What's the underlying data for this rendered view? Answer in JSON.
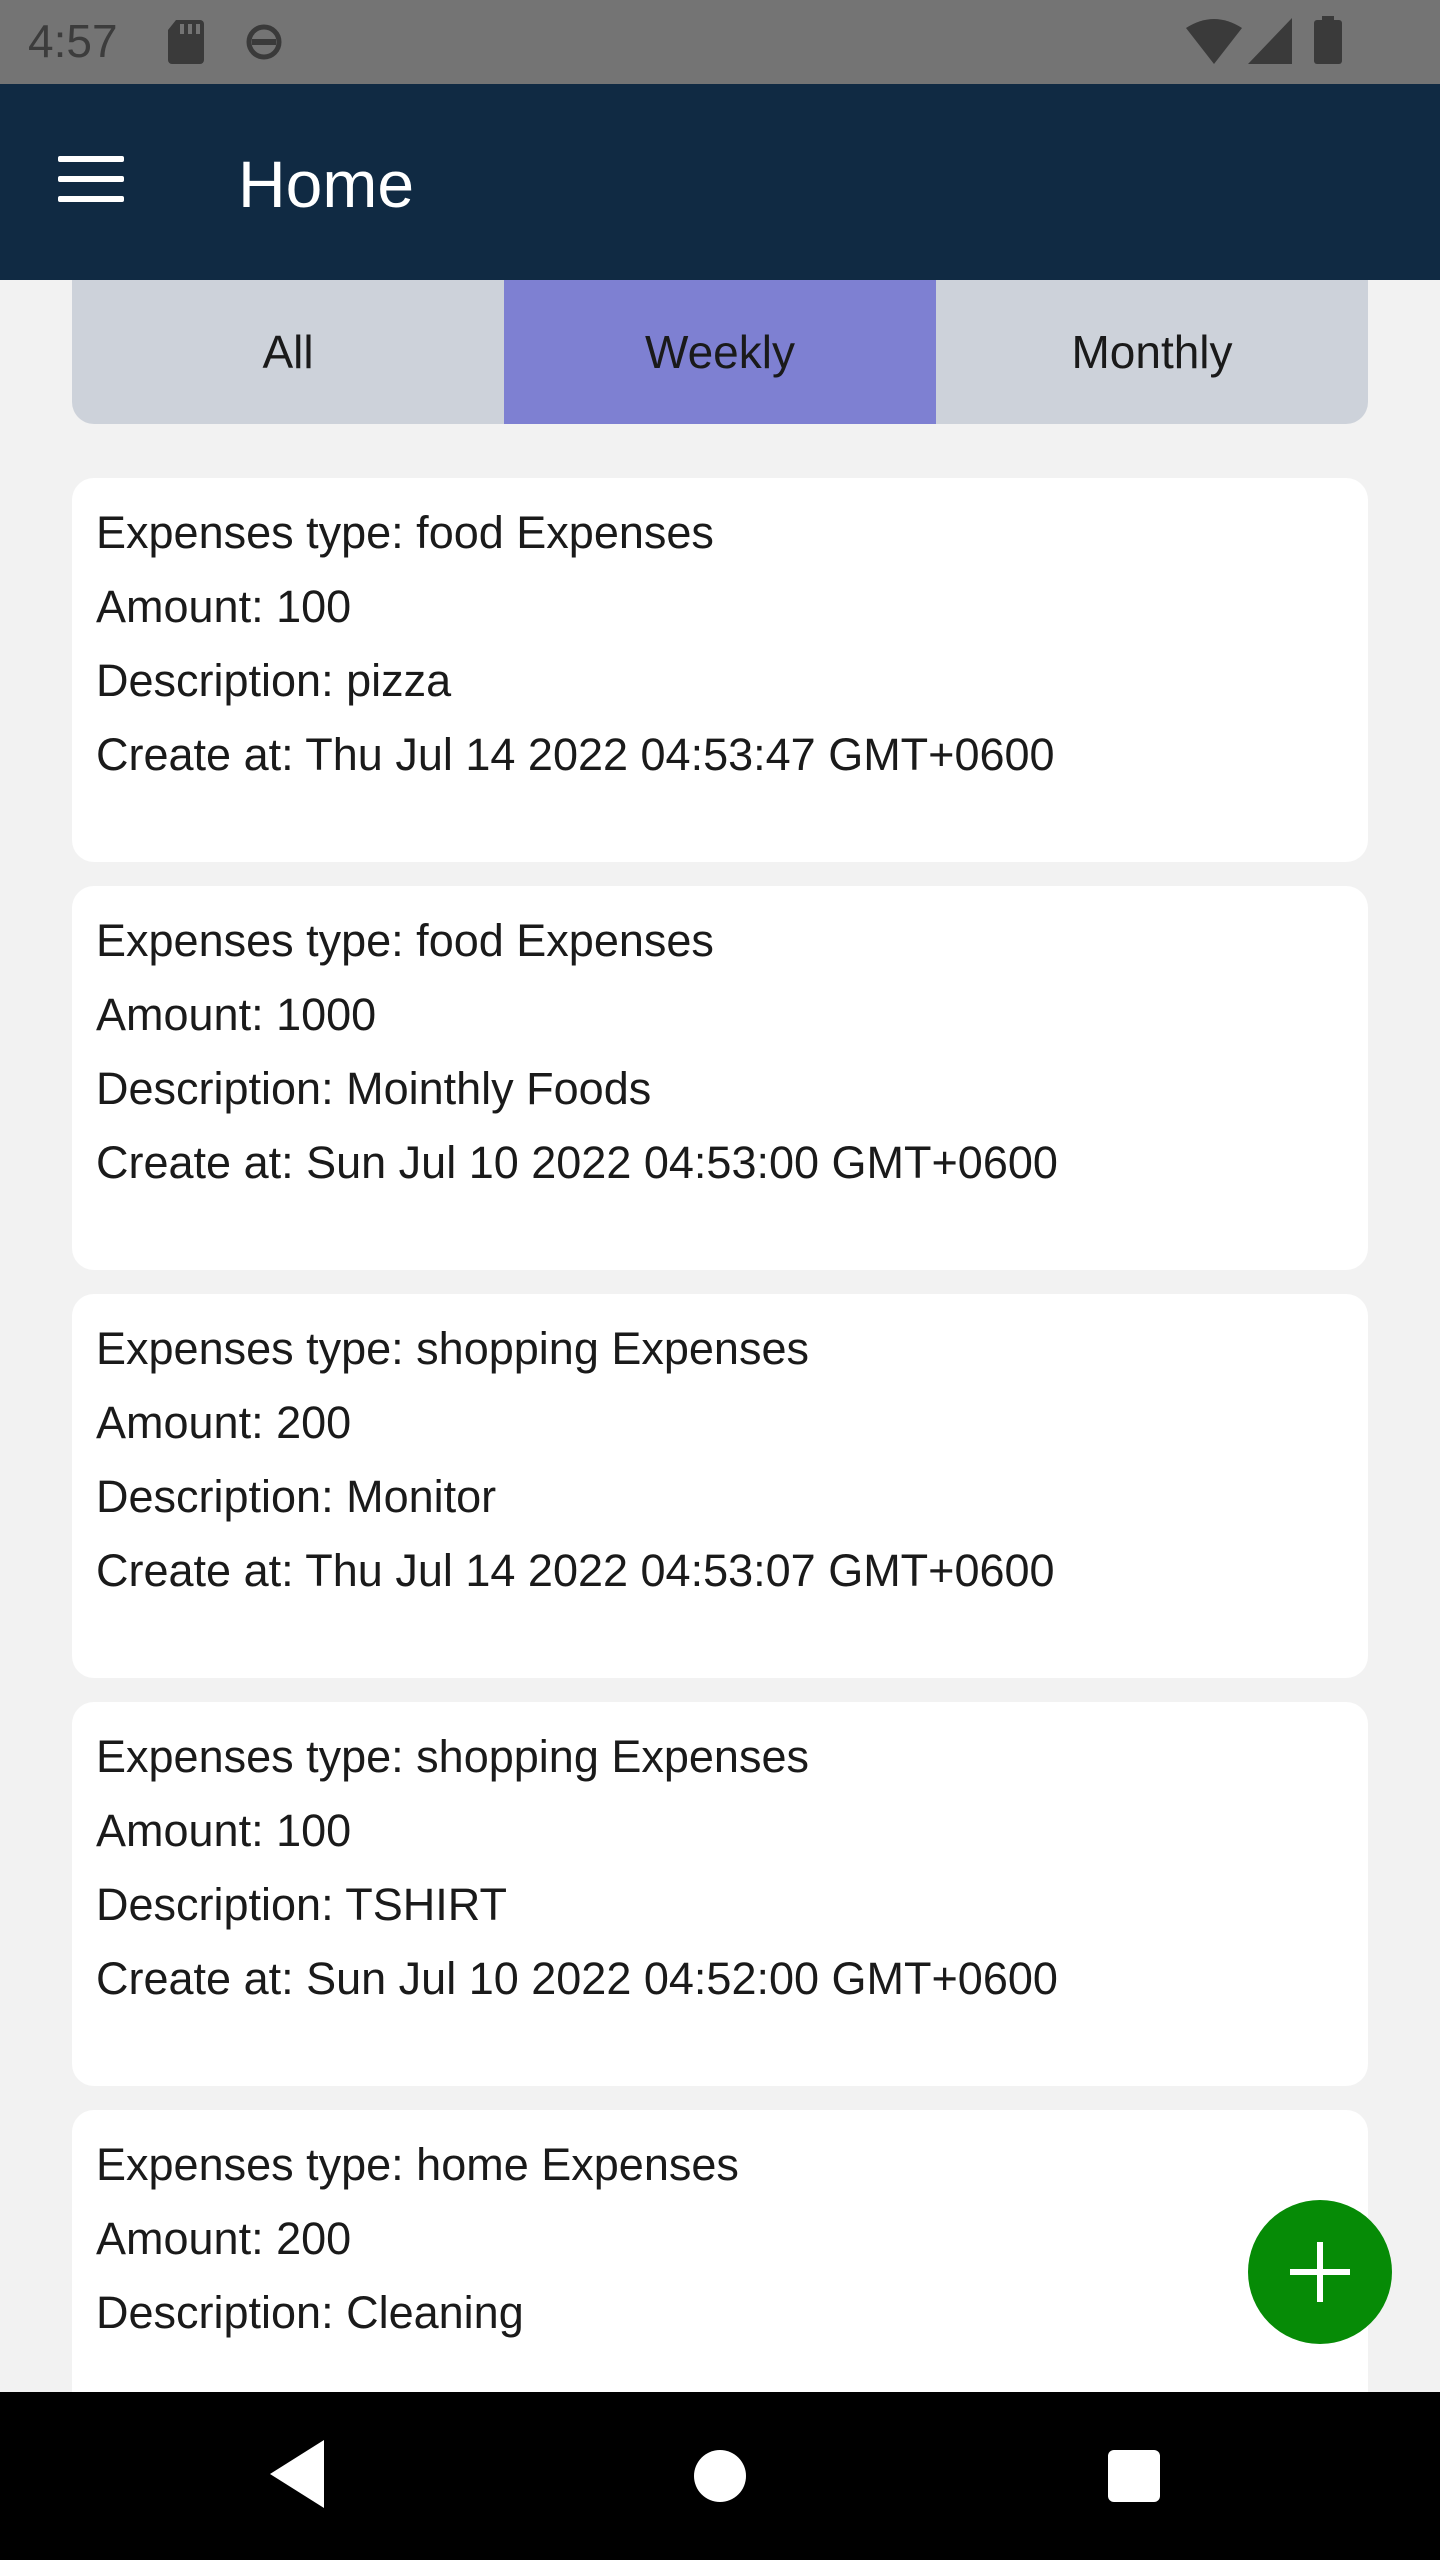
{
  "status_bar": {
    "time": "4:57",
    "icons": [
      "sd-card-icon",
      "sync-icon",
      "wifi-icon",
      "signal-icon",
      "battery-icon"
    ]
  },
  "app_bar": {
    "title": "Home",
    "menu_icon": "hamburger-menu-icon"
  },
  "tabs": [
    {
      "label": "All",
      "active": false
    },
    {
      "label": "Weekly",
      "active": true
    },
    {
      "label": "Monthly",
      "active": false
    }
  ],
  "colors": {
    "app_bar": "#102a43",
    "tab_bg": "#cdd2da",
    "tab_active": "#7e80d2",
    "fab": "#068b06"
  },
  "expenses": [
    {
      "type": "Expenses type: food Expenses",
      "amount": "Amount: 100",
      "description": "Description: pizza",
      "created": "Create at: Thu Jul 14 2022 04:53:47 GMT+0600"
    },
    {
      "type": "Expenses type: food Expenses",
      "amount": "Amount: 1000",
      "description": "Description: Mointhly Foods",
      "created": "Create at: Sun Jul 10 2022 04:53:00 GMT+0600"
    },
    {
      "type": "Expenses type: shopping Expenses",
      "amount": "Amount: 200",
      "description": "Description: Monitor",
      "created": "Create at: Thu Jul 14 2022 04:53:07 GMT+0600"
    },
    {
      "type": "Expenses type: shopping Expenses",
      "amount": "Amount: 100",
      "description": "Description: TSHIRT",
      "created": "Create at: Sun Jul 10 2022 04:52:00 GMT+0600"
    },
    {
      "type": "Expenses type: home Expenses",
      "amount": "Amount: 200",
      "description": "Description: Cleaning",
      "created": ""
    }
  ],
  "fab": {
    "icon": "plus-icon"
  },
  "nav_bar": {
    "icons": [
      "back-icon",
      "home-icon",
      "recent-apps-icon"
    ]
  }
}
